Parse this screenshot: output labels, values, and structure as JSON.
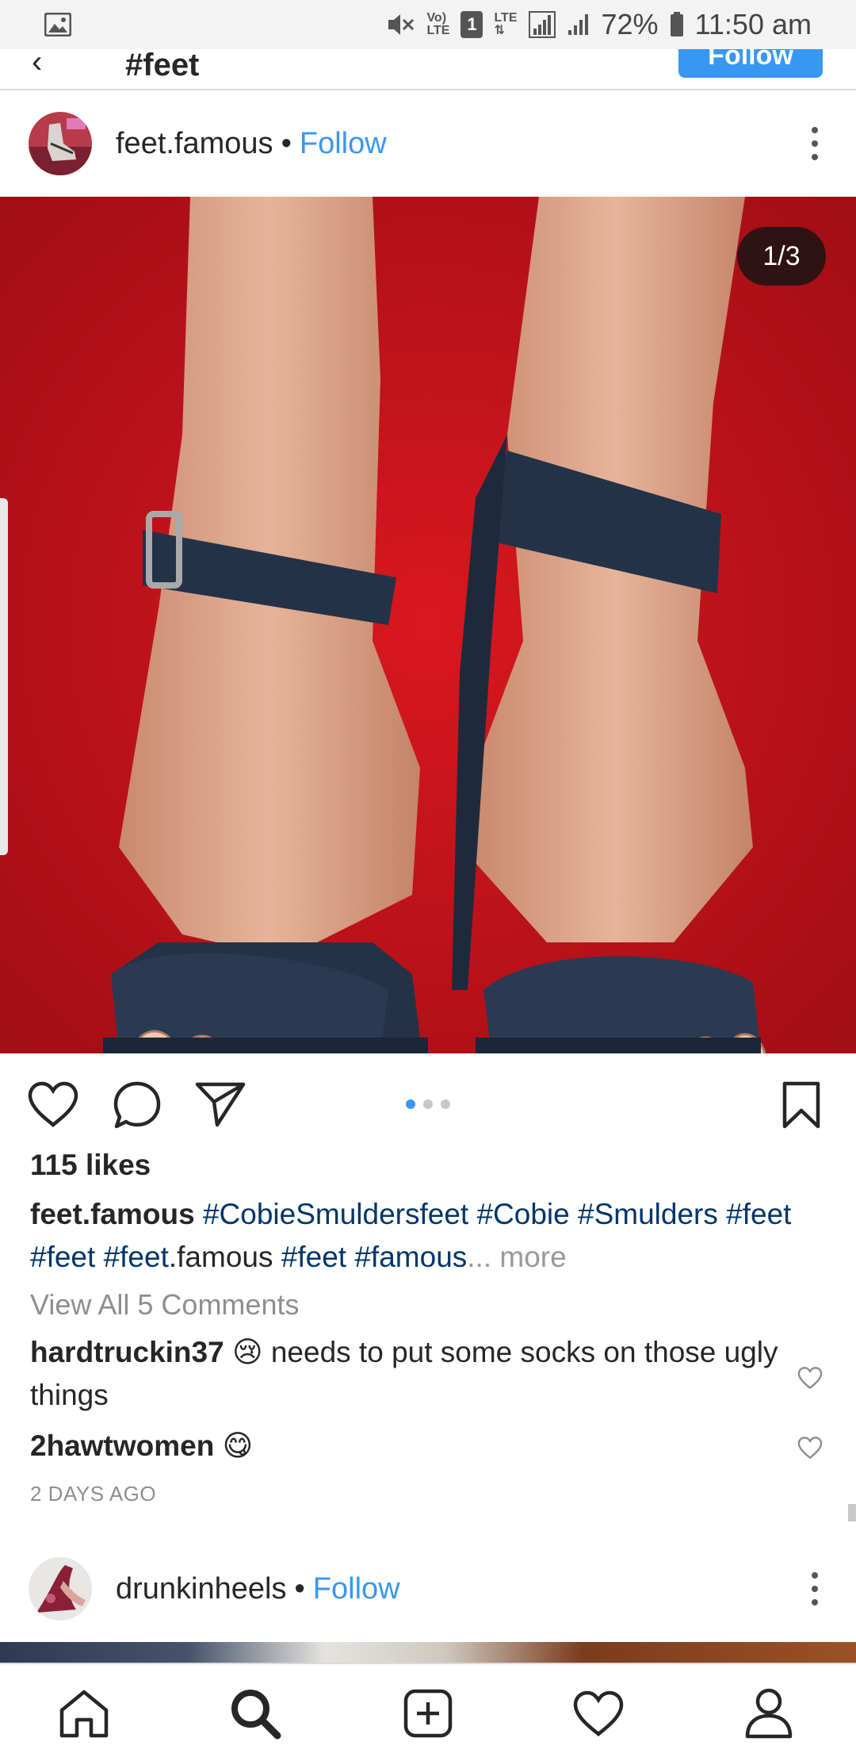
{
  "status_bar": {
    "volte": "Vo)",
    "volte_sub": "LTE",
    "sim": "1",
    "lte": "LTE",
    "battery_percent": "72%",
    "time": "11:50 am"
  },
  "header": {
    "back_icon": "back-arrow-icon",
    "title": "#feet",
    "follow_button": "Follow"
  },
  "post": {
    "username": "feet.famous",
    "separator": "•",
    "follow_label": "Follow",
    "photo_counter": "1/3",
    "carousel": {
      "count": 3,
      "active": 0
    },
    "likes": "115 likes",
    "caption": {
      "user": "feet.famous",
      "tag1": "#CobieSmuldersfeet",
      "tag2": "#Cobie",
      "tag3": "#Smulders",
      "tag4": "#feet",
      "tag5": "#feet",
      "tag6": "#feet",
      "tag6_suffix": ".famous",
      "tag7": "#feet",
      "tag8": "#famous",
      "ellipsis": "...",
      "more": "more"
    },
    "view_comments": "View All 5 Comments",
    "comments": [
      {
        "user": "hardtruckin37",
        "emoji": "😢",
        "text": "needs to put some socks on those ugly things"
      },
      {
        "user": "2hawtwomen",
        "emoji": "😋",
        "text": ""
      }
    ],
    "timestamp": "2 DAYS AGO"
  },
  "next_post": {
    "username": "drunkinheels",
    "separator": "•",
    "follow_label": "Follow"
  },
  "bottom_nav": [
    "home-icon",
    "search-icon",
    "add-post-icon",
    "activity-heart-icon",
    "profile-icon"
  ],
  "colors": {
    "accent_blue": "#3897f0",
    "hashtag_blue": "#003569",
    "muted_gray": "#8e8e8e",
    "carpet_red": "#c8141c"
  }
}
